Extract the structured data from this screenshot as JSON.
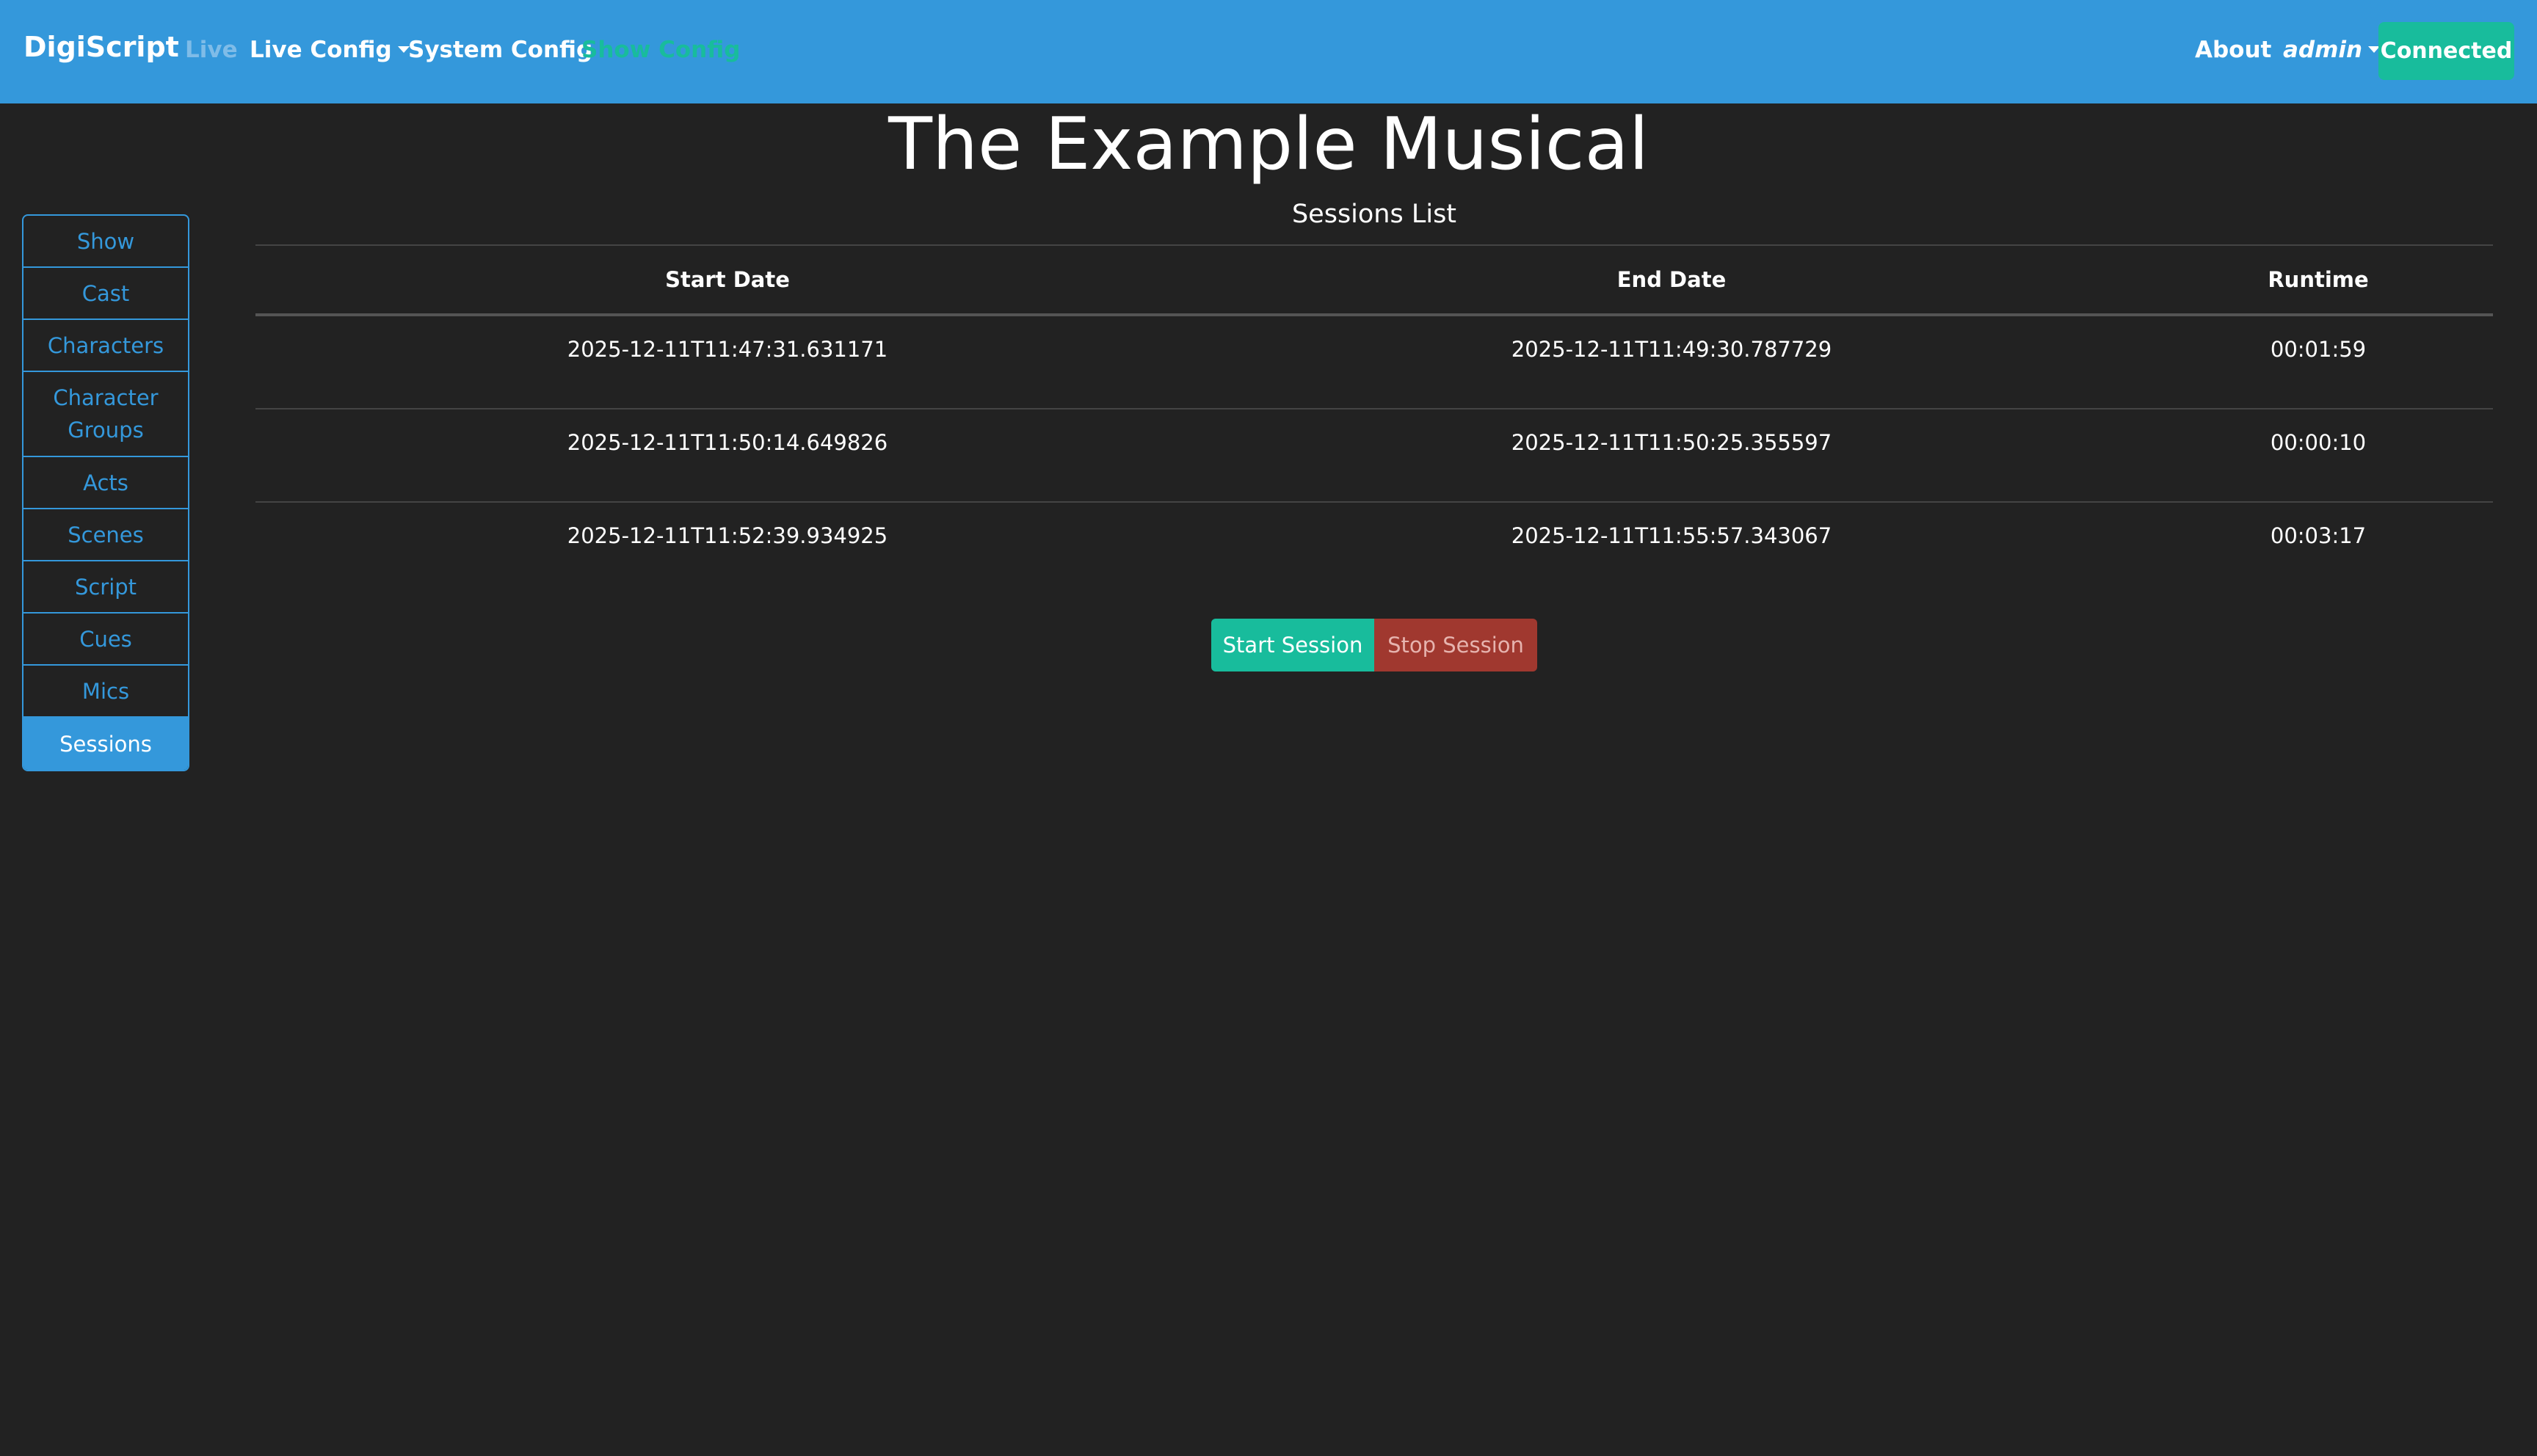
{
  "navbar": {
    "brand": "DigiScript",
    "live": "Live",
    "live_config": "Live Config",
    "system_config": "System Config",
    "show_config": "Show Config",
    "about": "About",
    "user": "admin",
    "status": "Connected"
  },
  "show": {
    "title": "The Example Musical"
  },
  "sidebar": {
    "items": [
      {
        "label": "Show"
      },
      {
        "label": "Cast"
      },
      {
        "label": "Characters"
      },
      {
        "label": "Character Groups"
      },
      {
        "label": "Acts"
      },
      {
        "label": "Scenes"
      },
      {
        "label": "Script"
      },
      {
        "label": "Cues"
      },
      {
        "label": "Mics"
      },
      {
        "label": "Sessions"
      }
    ],
    "active": "Sessions"
  },
  "sessions": {
    "title": "Sessions List",
    "columns": [
      "Start Date",
      "End Date",
      "Runtime"
    ],
    "rows": [
      {
        "start": "2025-12-11T11:47:31.631171",
        "end": "2025-12-11T11:49:30.787729",
        "runtime": "00:01:59"
      },
      {
        "start": "2025-12-11T11:50:14.649826",
        "end": "2025-12-11T11:50:25.355597",
        "runtime": "00:00:10"
      },
      {
        "start": "2025-12-11T11:52:39.934925",
        "end": "2025-12-11T11:55:57.343067",
        "runtime": "00:03:17"
      }
    ],
    "start_button": "Start Session",
    "stop_button": "Stop Session"
  },
  "colors": {
    "navbar": "#3498db",
    "background": "#222222",
    "success": "#18bc9c",
    "danger": "#a0382f"
  }
}
